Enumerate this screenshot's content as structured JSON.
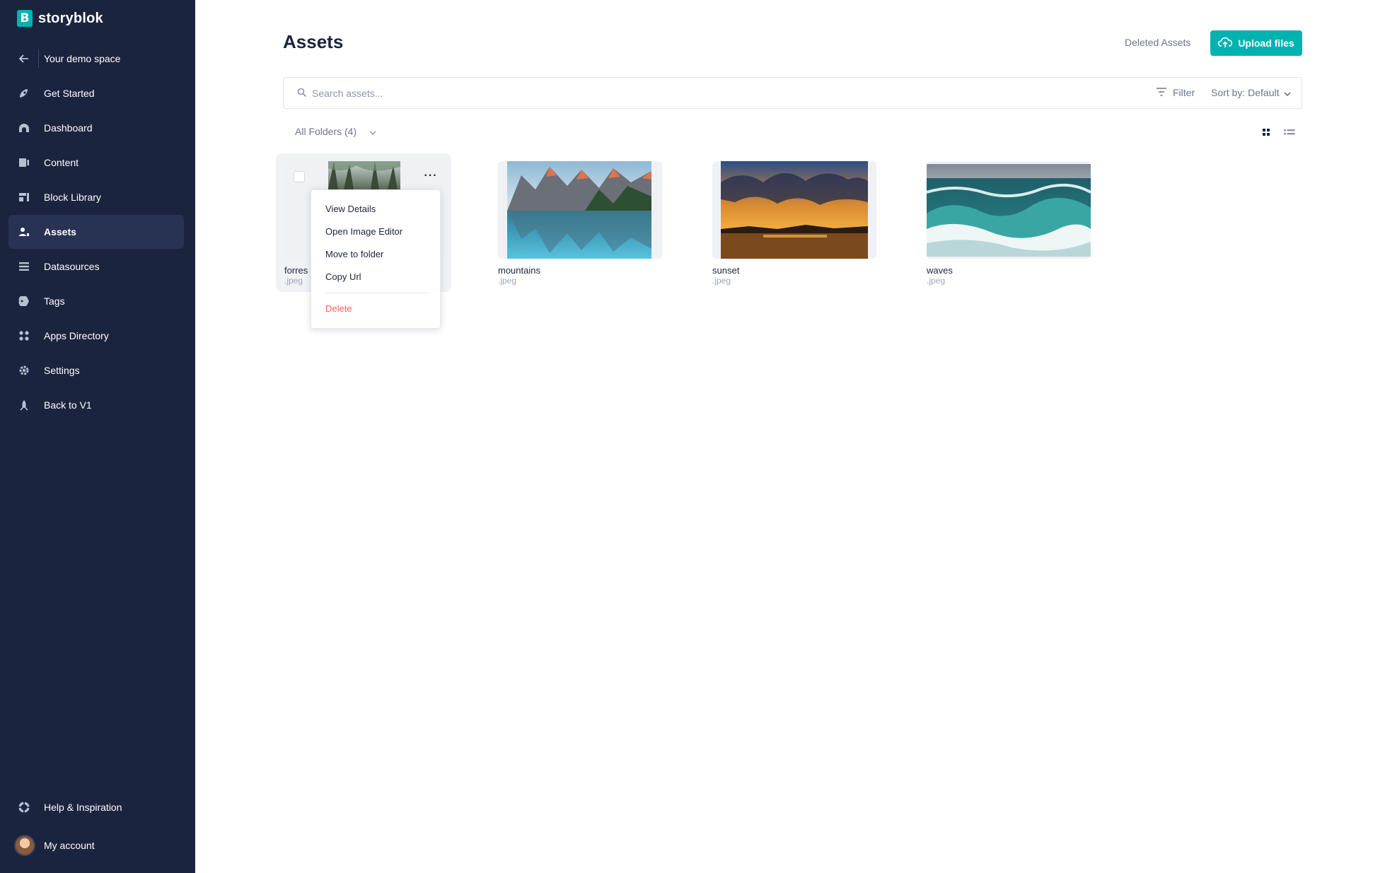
{
  "brand": {
    "name": "storyblok",
    "logo_letter": "B"
  },
  "sidebar": {
    "back_label": "Your demo space",
    "items": [
      {
        "label": "Get Started",
        "icon": "rocket-icon"
      },
      {
        "label": "Dashboard",
        "icon": "dashboard-icon"
      },
      {
        "label": "Content",
        "icon": "content-icon"
      },
      {
        "label": "Block Library",
        "icon": "blocks-icon"
      },
      {
        "label": "Assets",
        "icon": "assets-icon",
        "active": true
      },
      {
        "label": "Datasources",
        "icon": "datasources-icon"
      },
      {
        "label": "Tags",
        "icon": "tag-icon"
      },
      {
        "label": "Apps Directory",
        "icon": "apps-icon"
      },
      {
        "label": "Settings",
        "icon": "gear-icon"
      },
      {
        "label": "Back to V1",
        "icon": "back-v1-icon"
      }
    ],
    "help_label": "Help & Inspiration",
    "account_label": "My account"
  },
  "header": {
    "title": "Assets",
    "deleted_link": "Deleted Assets",
    "upload_label": "Upload files"
  },
  "search": {
    "placeholder": "Search assets...",
    "filter_label": "Filter",
    "sort_label": "Sort by: Default"
  },
  "folders": {
    "label": "All Folders (4)"
  },
  "assets": [
    {
      "name": "forres",
      "ext": ".jpeg"
    },
    {
      "name": "mountains",
      "ext": ".jpeg"
    },
    {
      "name": "sunset",
      "ext": ".jpeg"
    },
    {
      "name": "waves",
      "ext": ".jpeg"
    }
  ],
  "context_menu": {
    "items": [
      "View Details",
      "Open Image Editor",
      "Move to folder",
      "Copy Url"
    ],
    "danger_item": "Delete"
  },
  "colors": {
    "sidebar_bg": "#1b243f",
    "accent": "#00b3b0",
    "danger": "#ff6159"
  }
}
